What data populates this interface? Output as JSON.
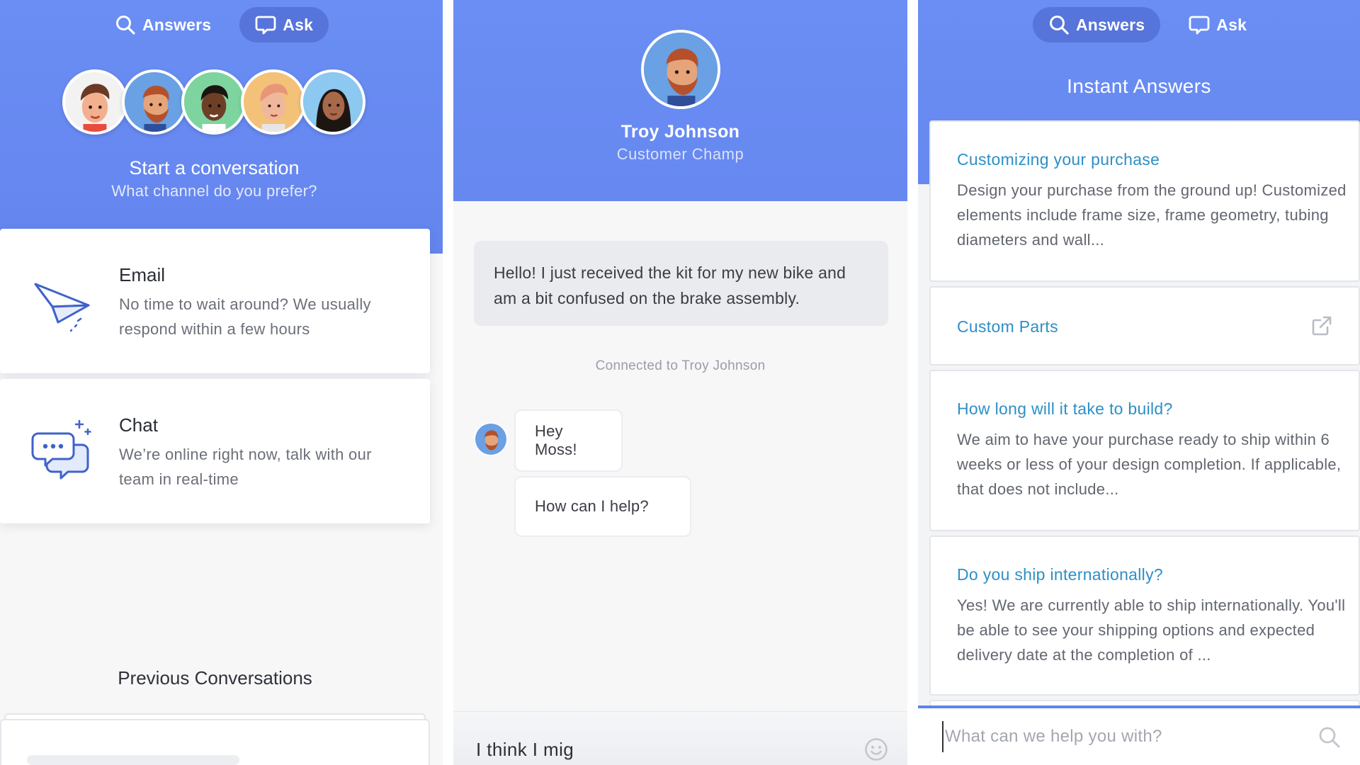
{
  "nav": {
    "answers_label": "Answers",
    "ask_label": "Ask"
  },
  "left": {
    "start_title": "Start a conversation",
    "start_subtitle": "What channel do you prefer?",
    "email": {
      "title": "Email",
      "description": "No time to wait around? We usually respond within a few hours"
    },
    "chat": {
      "title": "Chat",
      "description": "We’re online right now, talk with our team in real-time"
    },
    "previous_title": "Previous Conversations"
  },
  "middle": {
    "agent_name": "Troy Johnson",
    "agent_role": "Customer Champ",
    "user_message": "Hello! I just received the kit for my new bike and am a bit confused on the brake assembly.",
    "connected_text": "Connected to Troy Johnson",
    "agent_messages": [
      "Hey Moss!",
      "How can I help?"
    ],
    "composer_value": "I think I mig"
  },
  "right": {
    "title": "Instant Answers",
    "answers": [
      {
        "title": "Customizing your purchase",
        "body": "Design your purchase from the ground up! Customized elements include frame size, frame geometry, tubing diameters and wall..."
      },
      {
        "title": "Custom Parts",
        "icon": "external-link-icon"
      },
      {
        "title": "How long will it take to build?",
        "body": "We aim to have your purchase ready to ship within 6 weeks or less of your design completion. If applicable, that does not include..."
      },
      {
        "title": "Do you ship internationally?",
        "body": "Yes! We are currently able to ship internationally. You'll be able to see your shipping options and expected delivery date at the completion of ..."
      }
    ],
    "search_placeholder": "What can we help you with?"
  },
  "colors": {
    "header_blue": "#6a8ef4",
    "link_blue": "#2d8fc7",
    "accent_line": "#5f82ee"
  }
}
